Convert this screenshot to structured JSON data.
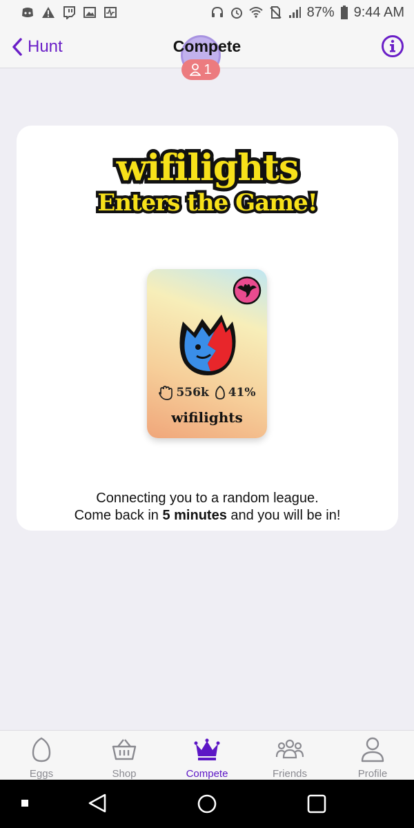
{
  "status_bar": {
    "battery": "87%",
    "time": "9:44 AM"
  },
  "header": {
    "back_label": "Hunt",
    "title": "Compete",
    "participants_count": "1"
  },
  "card": {
    "headline_line1": "wifilights",
    "headline_line2": "Enters the Game!",
    "egg": {
      "hunts": "556k",
      "percent": "41%",
      "name": "wifilights"
    },
    "message_line1": "Connecting you to a random league.",
    "message_pre": "Come back in ",
    "message_bold": "5 minutes",
    "message_post": " and you will be in!"
  },
  "bottom_nav": [
    {
      "label": "Eggs",
      "icon": "egg-icon"
    },
    {
      "label": "Shop",
      "icon": "basket-icon"
    },
    {
      "label": "Compete",
      "icon": "crown-icon",
      "active": true
    },
    {
      "label": "Friends",
      "icon": "friends-icon"
    },
    {
      "label": "Profile",
      "icon": "profile-icon"
    }
  ],
  "colors": {
    "accent": "#5c16c5",
    "headline_yellow": "#f7e11a",
    "pill": "#ec7b7f"
  }
}
